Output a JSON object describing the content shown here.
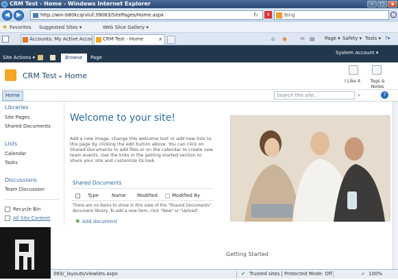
{
  "window": {
    "title": "CRM Test - Home - Windows Internet Explorer",
    "minimize": "–",
    "maximize": "□",
    "close": "x"
  },
  "address": {
    "back": "◀",
    "forward": "▶",
    "url": "http://win-b80kcqrvluf:39083/SitePages/Home.aspx",
    "refresh": "↻",
    "stop": "x",
    "search_placeholder": "Bing"
  },
  "favorites": {
    "label": "Favorites",
    "suggested": "Suggested Sites ▾",
    "gallery": "Web Slice Gallery ▾"
  },
  "tabs": [
    {
      "label": "Accounts: My Active Accoun..."
    },
    {
      "label": "CRM Test - Home"
    }
  ],
  "toolbar": {
    "page": "Page ▾",
    "safety": "Safety ▾",
    "tools": "Tools ▾",
    "help": "?▾"
  },
  "ribbon": {
    "site_actions": "Site Actions ▾",
    "browse": "Browse",
    "page": "Page",
    "user": "System Account ▾"
  },
  "site": {
    "title": "CRM Test",
    "separator": "▸",
    "breadcrumb": "Home",
    "i_like_it": "I Like It",
    "tags_notes": "Tags & Notes"
  },
  "topnav": {
    "home": "Home",
    "search_placeholder": "Search this site...",
    "help": "?"
  },
  "quicklaunch": {
    "libraries": "Libraries",
    "site_pages": "Site Pages",
    "shared_documents": "Shared Documents",
    "lists": "Lists",
    "calendar": "Calendar",
    "tasks": "Tasks",
    "discussions": "Discussions",
    "team_discussion": "Team Discussion",
    "recycle_bin": "Recycle Bin",
    "all_site_content": "All Site Content"
  },
  "main": {
    "welcome": "Welcome to your site!",
    "intro": "Add a new image, change this welcome text or add new lists to this page by clicking the edit button above. You can click on Shared Documents to add files or on the calendar to create new team events. Use the links in the getting started section to share your site and customize its look.",
    "shared_docs_title": "Shared Documents",
    "columns": [
      "Type",
      "Name",
      "Modified",
      "Modified By"
    ],
    "empty_message": "There are no items to show in this view of the \"Shared Documents\" document library. To add a new item, click \"New\" or \"Upload\".",
    "add_document": "Add document",
    "getting_started": "Getting Started"
  },
  "status": {
    "url": "083/_layouts/viewlsts.aspx",
    "zone": "Trusted sites | Protected Mode: Off",
    "zoom": "100%"
  }
}
